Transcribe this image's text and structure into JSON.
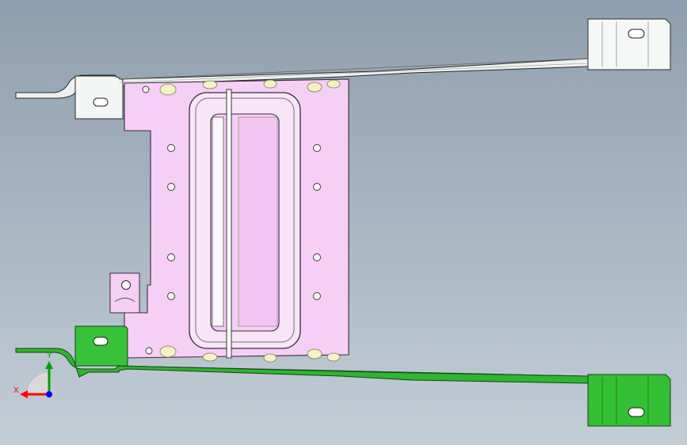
{
  "viewport": {
    "background_top": "#8f9eae",
    "background_bottom": "#c3cdd6"
  },
  "model": {
    "center_plate_color": "#f6cff6",
    "top_rail_color": "#eef0f0",
    "bottom_rail_color": "#26b026",
    "bottom_rail_dark": "#1f7d1f",
    "highlight_dot_color": "#f4f1c7"
  },
  "triad": {
    "x_label": "X",
    "y_label": "Y",
    "x_color": "#ff0000",
    "y_color": "#00a000",
    "z_color": "#0000ff"
  }
}
